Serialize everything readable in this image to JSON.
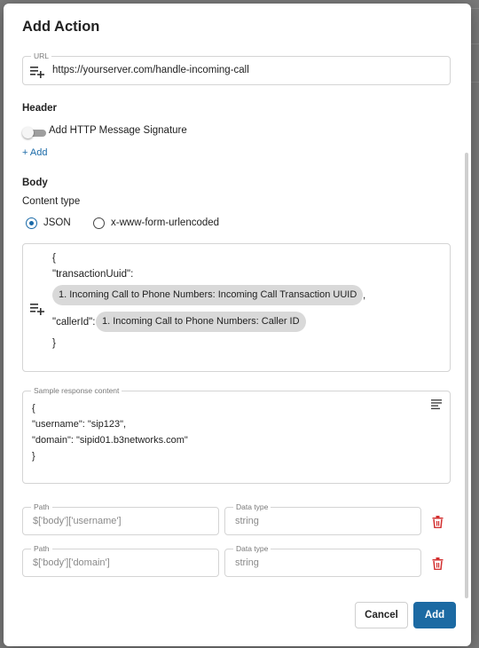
{
  "dialog": {
    "title": "Add Action"
  },
  "url": {
    "label": "URL",
    "value": "https://yourserver.com/handle-incoming-call"
  },
  "header": {
    "title": "Header",
    "signature_label": "Add HTTP Message Signature",
    "signature_enabled": false,
    "add_link": "+ Add"
  },
  "body": {
    "title": "Body",
    "content_type_label": "Content type",
    "options": [
      {
        "label": "JSON",
        "selected": true
      },
      {
        "label": "x-www-form-urlencoded",
        "selected": false
      }
    ],
    "editor": {
      "open_brace": "{",
      "key1": "\"transactionUuid\":",
      "chip1": "1. Incoming Call to Phone Numbers: Incoming Call Transaction UUID",
      "comma": ",",
      "key2": "\"callerId\":",
      "chip2": "1. Incoming Call to Phone Numbers: Caller ID",
      "close_brace": "}"
    }
  },
  "sample": {
    "label": "Sample response content",
    "lines": [
      "{",
      "\"username\": \"sip123\",",
      "\"domain\": \"sipid01.b3networks.com\"",
      "}"
    ]
  },
  "mappings": [
    {
      "path_label": "Path",
      "path": "$['body']['username']",
      "type_label": "Data type",
      "type": "string"
    },
    {
      "path_label": "Path",
      "path": "$['body']['domain']",
      "type_label": "Data type",
      "type": "string"
    }
  ],
  "footer": {
    "cancel": "Cancel",
    "add": "Add"
  },
  "colors": {
    "accent": "#1c6aa3",
    "link": "#1a6aa8",
    "delete": "#d32f2f",
    "chip": "#d9d9d9"
  },
  "icons": {
    "insert_variable": "playlist-add-icon",
    "wrap": "wrap-text-icon",
    "delete": "trash-icon"
  }
}
